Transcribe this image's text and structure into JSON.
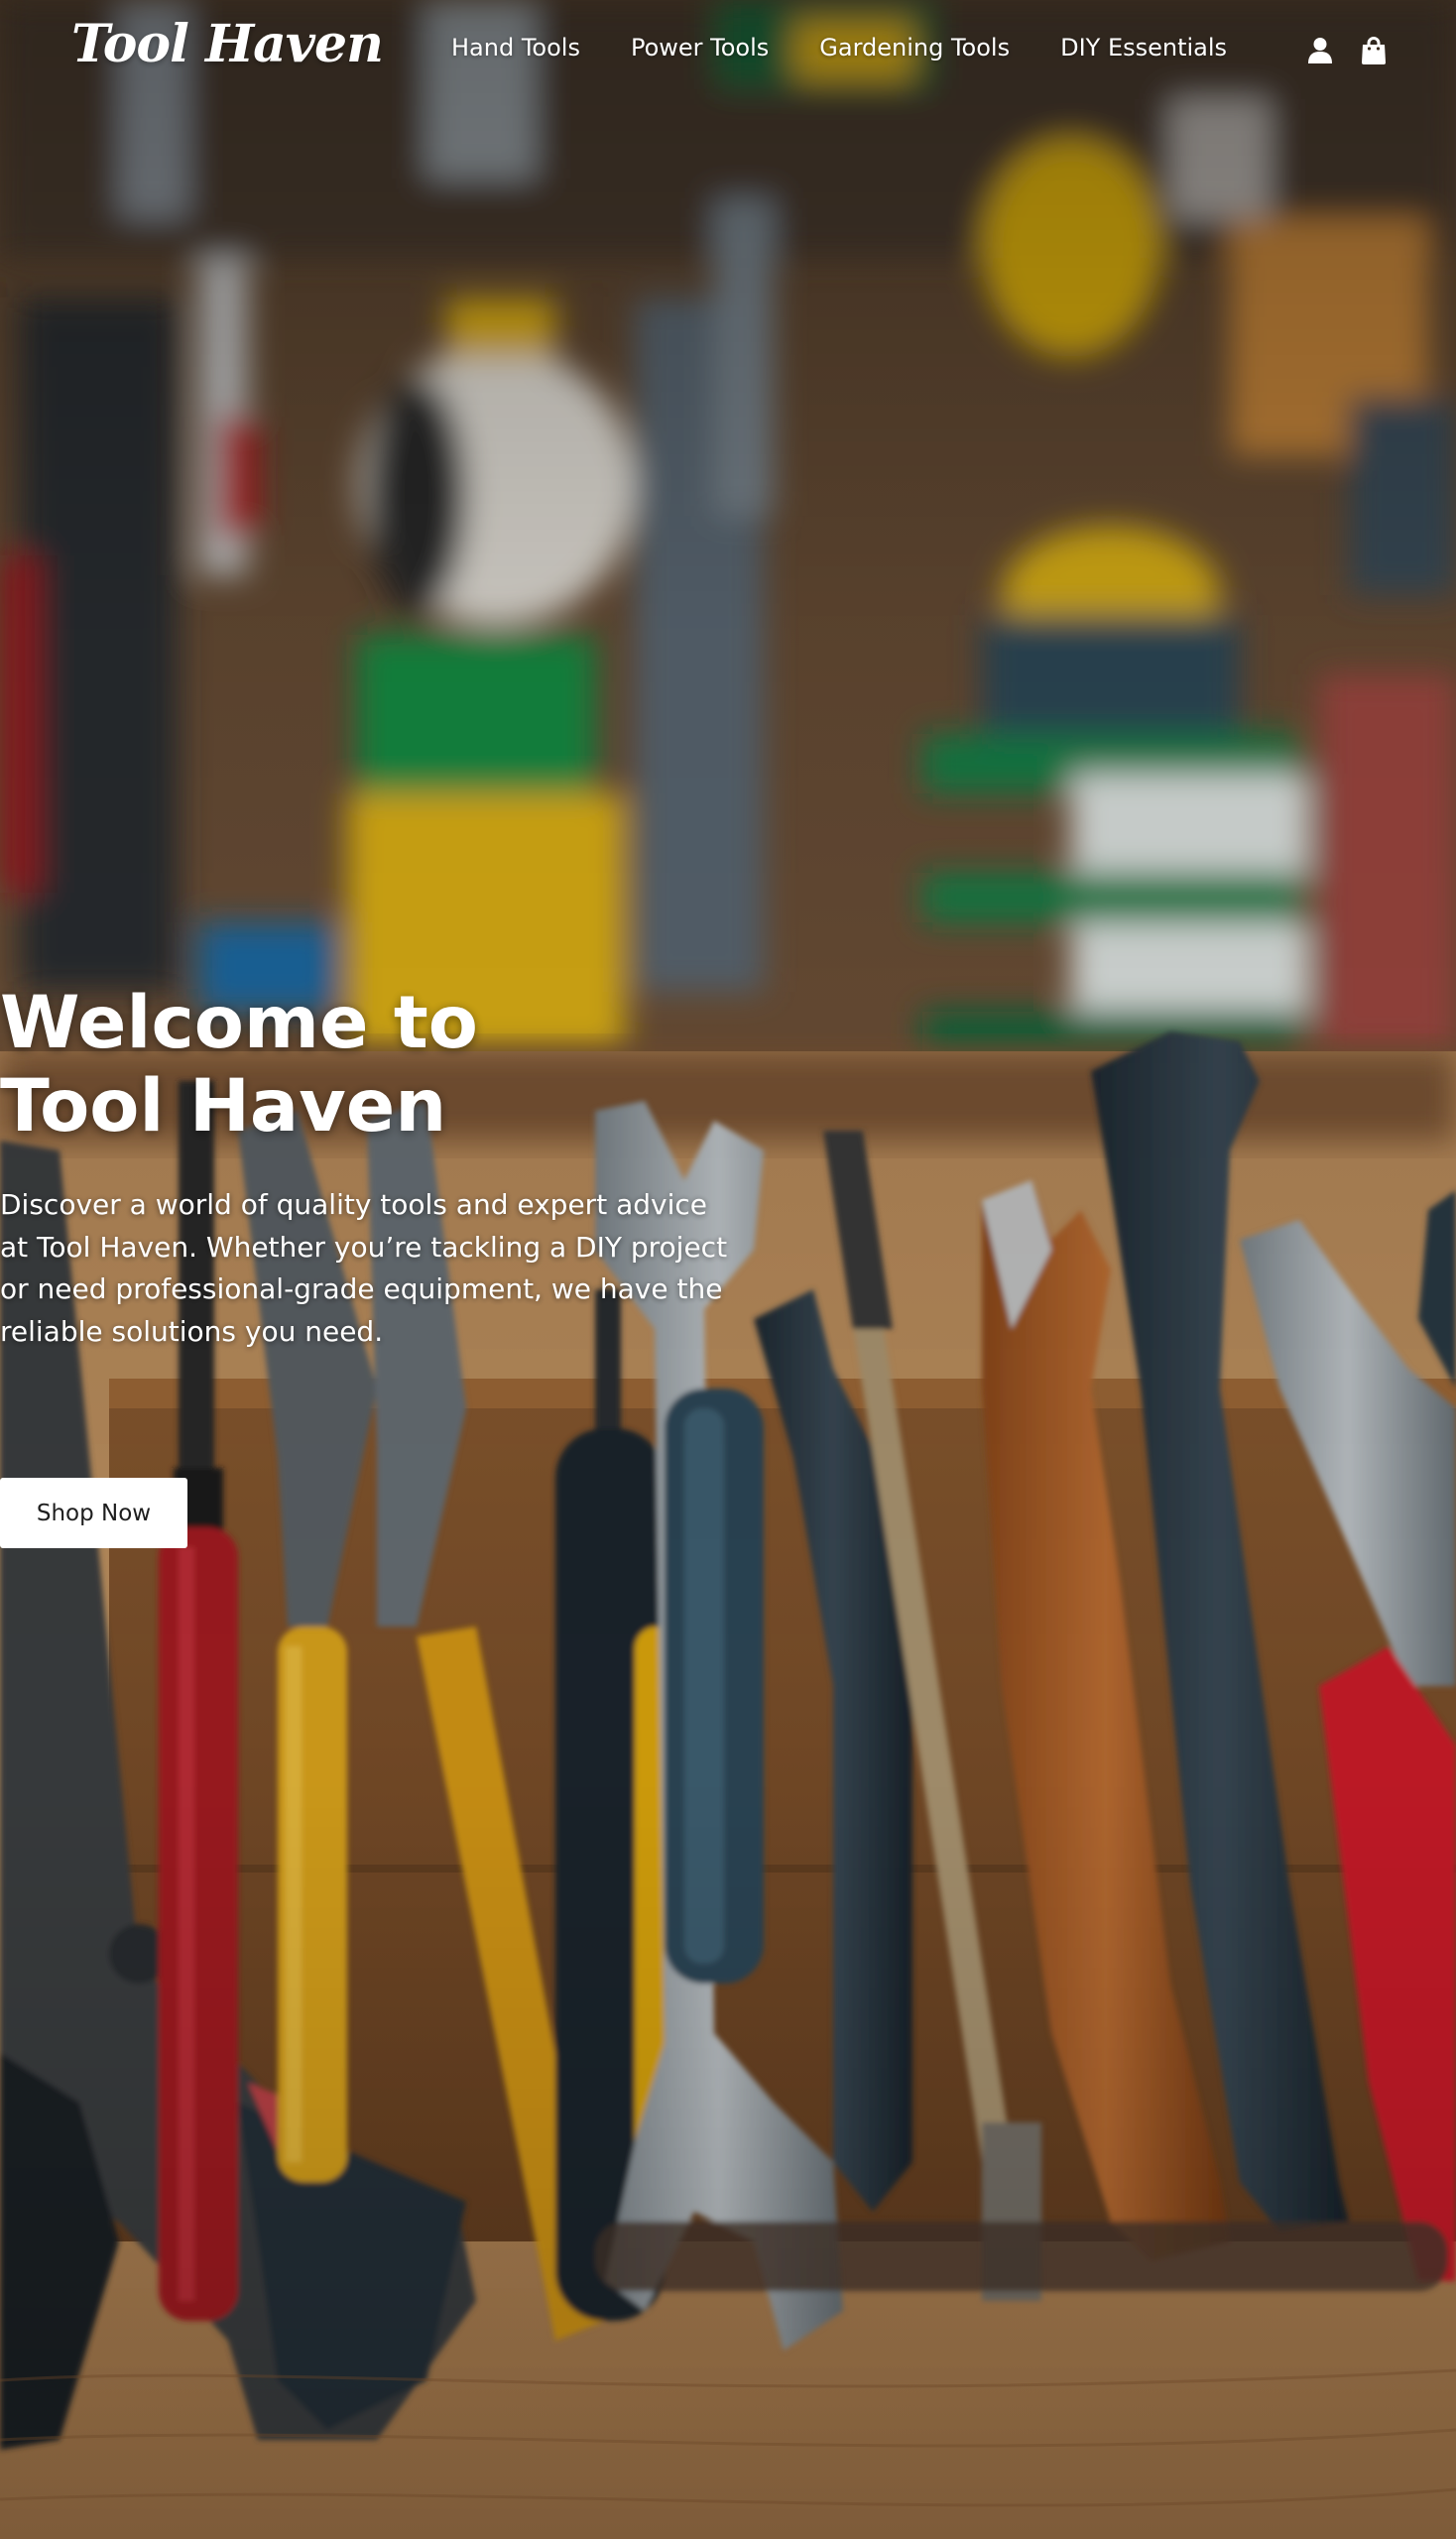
{
  "header": {
    "logo": "Tool Haven",
    "nav": [
      {
        "label": "Hand Tools"
      },
      {
        "label": "Power Tools"
      },
      {
        "label": "Gardening Tools"
      },
      {
        "label": "DIY Essentials"
      }
    ],
    "icons": [
      "user-icon",
      "shopping-bag-icon"
    ]
  },
  "hero": {
    "title": "Welcome to Tool Haven",
    "description": "Discover a world of quality tools and expert advice at Tool Haven. Whether you’re tackling a DIY project or need professional-grade equipment, we have the reliable solutions you need.",
    "cta_label": "Shop Now",
    "background_subject": "tools-on-workbench"
  },
  "colors": {
    "text": "#ffffff",
    "button_bg": "#ffffff",
    "button_text": "#1e1e1e"
  }
}
